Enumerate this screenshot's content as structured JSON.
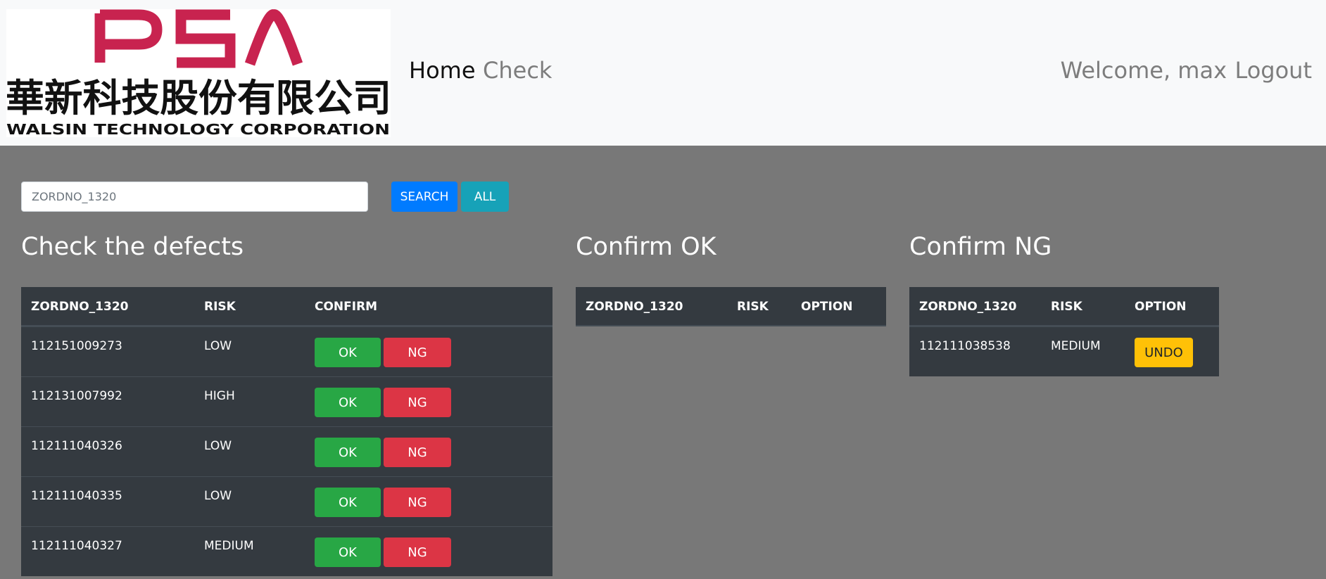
{
  "logo": {
    "brand": "PSA",
    "company_zh": "華新科技股份有限公司",
    "company_en": "WALSIN TECHNOLOGY CORPORATION",
    "brand_color": "#c8234f"
  },
  "nav": {
    "home": "Home",
    "check": "Check",
    "welcome": "Welcome, max",
    "logout": "Logout"
  },
  "search": {
    "placeholder": "ZORDNO_1320",
    "value": "",
    "search_label": "SEARCH",
    "all_label": "ALL"
  },
  "colors": {
    "background": "#787878",
    "table": "#343a40",
    "ok": "#28a745",
    "ng": "#dc3545",
    "undo": "#ffc107",
    "search": "#007bff",
    "all": "#17a2b8"
  },
  "check": {
    "title": "Check the defects",
    "headers": [
      "ZORDNO_1320",
      "RISK",
      "CONFIRM"
    ],
    "ok_label": "OK",
    "ng_label": "NG",
    "rows": [
      {
        "zordno": "112151009273",
        "risk": "LOW"
      },
      {
        "zordno": "112131007992",
        "risk": "HIGH"
      },
      {
        "zordno": "112111040326",
        "risk": "LOW"
      },
      {
        "zordno": "112111040335",
        "risk": "LOW"
      },
      {
        "zordno": "112111040327",
        "risk": "MEDIUM"
      }
    ]
  },
  "confirm_ok": {
    "title": "Confirm OK",
    "headers": [
      "ZORDNO_1320",
      "RISK",
      "OPTION"
    ],
    "rows": []
  },
  "confirm_ng": {
    "title": "Confirm NG",
    "headers": [
      "ZORDNO_1320",
      "RISK",
      "OPTION"
    ],
    "undo_label": "UNDO",
    "rows": [
      {
        "zordno": "112111038538",
        "risk": "MEDIUM"
      }
    ]
  }
}
